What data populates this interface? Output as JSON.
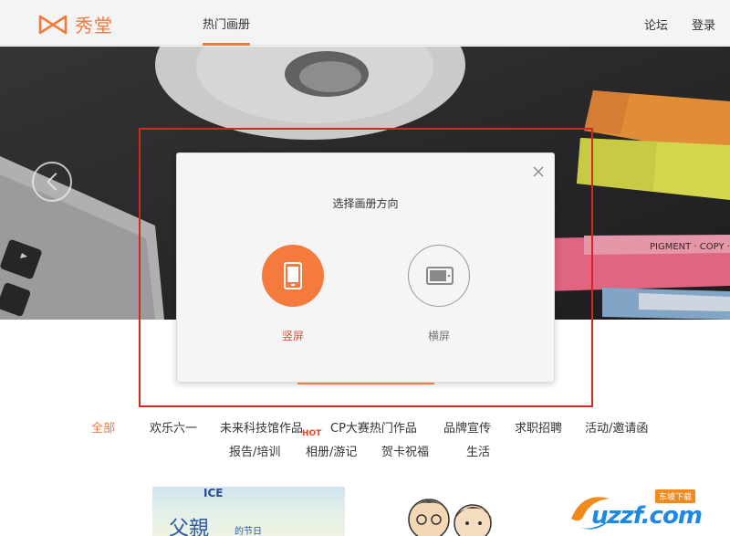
{
  "header": {
    "logo_text": "秀堂",
    "nav": [
      {
        "label": "热门画册",
        "active": true
      },
      {
        "label": "论坛"
      },
      {
        "label": "登录"
      }
    ],
    "accent_color": "#f27a3f"
  },
  "hero": {
    "pigment_text": "PIGMENT · COPY ·"
  },
  "modal": {
    "title": "选择画册方向",
    "options": [
      {
        "label": "竖屏",
        "icon": "portrait-phone-icon",
        "selected": true
      },
      {
        "label": "横屏",
        "icon": "landscape-phone-icon",
        "selected": false
      }
    ],
    "close_icon": "close-icon"
  },
  "categories": {
    "row1": [
      "全部",
      "欢乐六一",
      "未来科技馆作品",
      "CP大赛热门作品",
      "品牌宣传",
      "求职招聘",
      "活动/邀请函"
    ],
    "row2": [
      "报告/培训",
      "相册/游记",
      "贺卡祝福",
      "生活"
    ],
    "hot_badge": "HOT"
  },
  "thumbnails": {
    "first_title": "父親",
    "first_subtitle": "的节日",
    "first_top": "ICE"
  },
  "watermark": {
    "text": "uzzf.com",
    "badge": "东坡下载"
  }
}
